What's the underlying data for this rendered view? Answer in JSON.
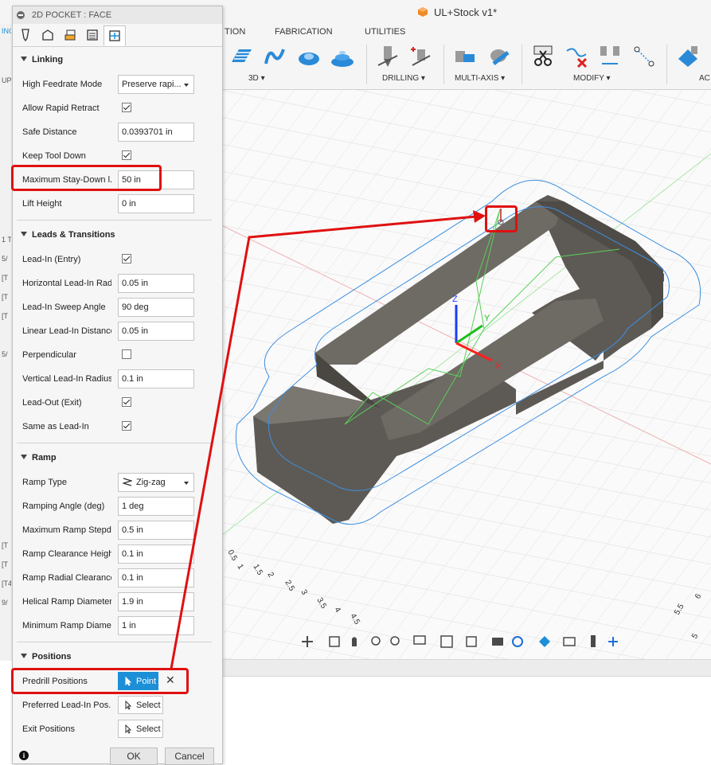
{
  "app": {
    "doc_title": "UL+Stock v1*",
    "tabs": [
      "TION",
      "FABRICATION",
      "UTILITIES"
    ],
    "groups": [
      "3D",
      "DRILLING",
      "MULTI-AXIS",
      "MODIFY",
      "AC"
    ],
    "browser_labels": [
      "INC",
      "UP",
      "1 T",
      "5/",
      "[T",
      "[T",
      "[T",
      "5/",
      "[T",
      "[T",
      "[T4",
      "9/"
    ]
  },
  "dialog": {
    "title": "2D POCKET : FACE",
    "sections": {
      "linking": "Linking",
      "leads": "Leads & Transitions",
      "ramp": "Ramp",
      "positions": "Positions"
    },
    "linking": {
      "high_feedrate_mode": {
        "label": "High Feedrate Mode",
        "value": "Preserve rapi..."
      },
      "allow_rapid_retract": {
        "label": "Allow Rapid Retract",
        "checked": true
      },
      "safe_distance": {
        "label": "Safe Distance",
        "value": "0.0393701 in"
      },
      "keep_tool_down": {
        "label": "Keep Tool Down",
        "checked": true
      },
      "max_stay_down": {
        "label": "Maximum Stay-Down l...",
        "value": "50 in"
      },
      "lift_height": {
        "label": "Lift Height",
        "value": "0 in"
      }
    },
    "leads": {
      "lead_in": {
        "label": "Lead-In (Entry)",
        "checked": true
      },
      "horiz_radius": {
        "label": "Horizontal Lead-In Rad...",
        "value": "0.05 in"
      },
      "sweep_angle": {
        "label": "Lead-In Sweep Angle",
        "value": "90 deg"
      },
      "linear_distance": {
        "label": "Linear Lead-In Distance",
        "value": "0.05 in"
      },
      "perpendicular": {
        "label": "Perpendicular",
        "checked": false
      },
      "vert_radius": {
        "label": "Vertical Lead-In Radius",
        "value": "0.1 in"
      },
      "lead_out": {
        "label": "Lead-Out (Exit)",
        "checked": true
      },
      "same_as_lead_in": {
        "label": "Same as Lead-In",
        "checked": true
      }
    },
    "ramp": {
      "type": {
        "label": "Ramp Type",
        "value": "Zig-zag"
      },
      "angle": {
        "label": "Ramping Angle (deg)",
        "value": "1 deg"
      },
      "max_stepdown": {
        "label": "Maximum Ramp Stepd...",
        "value": "0.5 in"
      },
      "clearance_height": {
        "label": "Ramp Clearance Height",
        "value": "0.1 in"
      },
      "radial_clearance": {
        "label": "Ramp Radial Clearance",
        "value": "0.1 in"
      },
      "helical_diameter": {
        "label": "Helical Ramp Diameter",
        "value": "1.9 in"
      },
      "min_diameter": {
        "label": "Minimum Ramp Diameter",
        "value": "1 in"
      }
    },
    "positions": {
      "predrill": {
        "label": "Predrill Positions",
        "button": "Point",
        "clear": "✕"
      },
      "preferred": {
        "label": "Preferred Lead-In Pos...",
        "button": "Select"
      },
      "exit": {
        "label": "Exit Positions",
        "button": "Select"
      }
    },
    "ok": "OK",
    "cancel": "Cancel",
    "info": "i"
  },
  "viewport": {
    "axis_x": "X",
    "axis_y": "Y",
    "axis_z": "Z",
    "grid_labels": [
      "0.5",
      "1",
      "1.5",
      "2",
      "2.5",
      "3",
      "3.5",
      "4",
      "4.5",
      "5",
      "5.5",
      "6"
    ]
  },
  "colors": {
    "highlight": "#e01010",
    "accent": "#1c8fd7",
    "part": "#5d5a55",
    "toolpath_blue": "#3c8fe0",
    "toolpath_green": "#5ad05a"
  }
}
